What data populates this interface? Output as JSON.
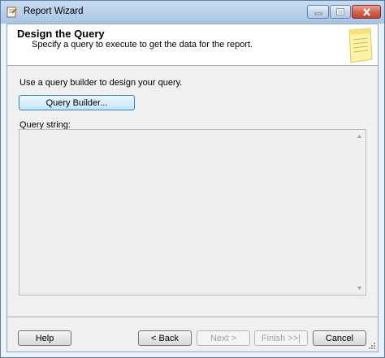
{
  "window": {
    "title": "Report Wizard",
    "icon": "report-wizard-icon",
    "minimize_icon": "minimize-icon",
    "maximize_icon": "maximize-icon",
    "close_icon": "close-icon"
  },
  "header": {
    "title": "Design the Query",
    "subtitle": "Specify a query to execute to get the data for the report.",
    "graphic": "document-icon"
  },
  "main": {
    "instruction": "Use a query builder to design your query.",
    "query_builder_label": "Query Builder...",
    "query_string_label": "Query string:",
    "query_string_value": ""
  },
  "footer": {
    "help_label": "Help",
    "back_label": "< Back",
    "next_label": "Next >",
    "finish_label": "Finish >>|",
    "cancel_label": "Cancel"
  },
  "colors": {
    "title_bar": "#b9d0ea",
    "close_button": "#d26652",
    "client_background": "#f0f0f0",
    "disabled_text": "#a0a0a0"
  }
}
